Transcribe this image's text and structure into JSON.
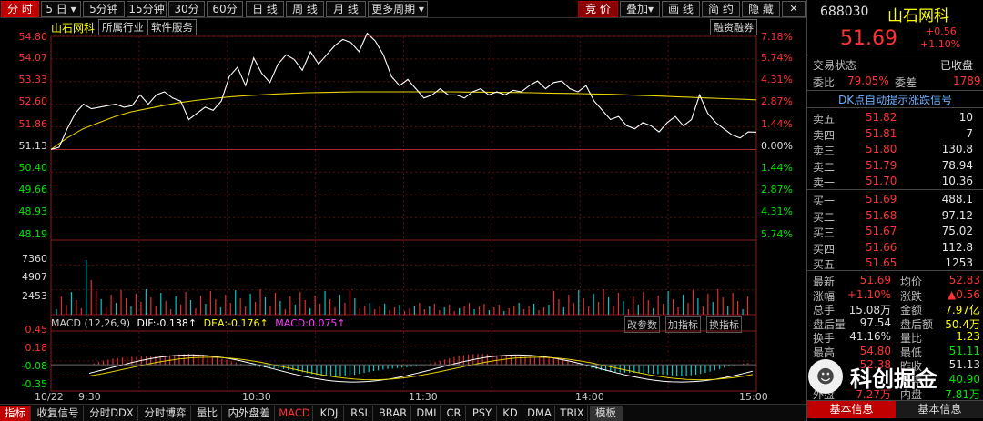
{
  "toolbar": {
    "left": [
      "分 时",
      "5 日",
      "5分钟",
      "15分钟",
      "30分钟",
      "60分钟",
      "日 线",
      "周 线",
      "月 线",
      "更多周期"
    ],
    "right": [
      "竞 价",
      "叠加",
      "画 线",
      "简 约",
      "隐 藏"
    ],
    "nav_icons": [
      "left-arrow-icon",
      "right-arrow-icon",
      "close-icon"
    ]
  },
  "chart": {
    "stock_name": "山石网科",
    "tags": [
      "所属行业",
      "软件服务"
    ],
    "margin_tag": "融资融券",
    "price_ticks": [
      "54.80",
      "54.07",
      "53.33",
      "52.60",
      "51.86",
      "51.13",
      "50.40",
      "49.66",
      "48.93",
      "48.19"
    ],
    "pct_ticks": [
      "7.18%",
      "5.74%",
      "4.31%",
      "2.87%",
      "1.44%",
      "0.00%",
      "1.44%",
      "2.87%",
      "4.31%",
      "5.74%"
    ],
    "vol_ticks": [
      "7360",
      "4907",
      "2453"
    ],
    "macd_ticks": [
      "0.45",
      "0.18",
      "-0.08",
      "-0.35"
    ],
    "macd_header": "MACD (12,26,9)",
    "dif": "DIF:-0.138↑",
    "dea": "DEA:-0.176↑",
    "macd": "MACD:0.075↑",
    "macd_buttons": [
      "改参数",
      "加指标",
      "换指标"
    ],
    "time_labels": [
      "10/22",
      "9:30",
      "10:30",
      "11:30",
      "14:00",
      "15:00"
    ],
    "colors": {
      "price_line": "#ffffff",
      "avg_line": "#e6d200",
      "up": "#ff3232",
      "down": "#00d2d2",
      "grid": "#7a1a1a"
    },
    "chart_data": {
      "type": "line",
      "title": "",
      "series": [
        {
          "name": "",
          "values": [
            51.13,
            51.2,
            51.8,
            52.3,
            52.6,
            52.45,
            52.5,
            52.55,
            52.6,
            52.5,
            52.55,
            52.9,
            52.6,
            52.9,
            53.0,
            52.8,
            52.7,
            52.1,
            52.3,
            52.5,
            52.4,
            52.7,
            53.5,
            53.8,
            53.2,
            54.1,
            53.6,
            53.3,
            53.9,
            54.2,
            54.05,
            53.7,
            54.3,
            53.9,
            54.2,
            54.5,
            54.7,
            54.6,
            54.3,
            54.9,
            54.65,
            54.2,
            53.5,
            53.2,
            53.4,
            53.1,
            52.8,
            52.9,
            53.1,
            52.9,
            52.9,
            52.8,
            53.0,
            53.1,
            52.9,
            53.0,
            52.9,
            53.05,
            53.0,
            53.2,
            53.35,
            53.1,
            53.3,
            53.35,
            53.1,
            53.0,
            53.2,
            52.7,
            52.4,
            52.1,
            52.2,
            51.9,
            51.8,
            52.0,
            51.9,
            51.7,
            52.0,
            52.2,
            51.9,
            52.1,
            52.9,
            52.3,
            52.0,
            51.8,
            51.6,
            51.5,
            51.7,
            51.69
          ]
        },
        {
          "name": "",
          "values": [
            51.13,
            51.5,
            51.8,
            52.0,
            52.2,
            52.35,
            52.45,
            52.55,
            52.65,
            52.72,
            52.78,
            52.83,
            52.87,
            52.9,
            52.93,
            52.95,
            52.97,
            52.98,
            52.99,
            53.0,
            53.0,
            53.0,
            53.0,
            53.0,
            53.0,
            53.0,
            52.99,
            52.99,
            52.98,
            52.98,
            52.97,
            52.96,
            52.95,
            52.94,
            52.93,
            52.92,
            52.9,
            52.88,
            52.86,
            52.84,
            52.82,
            52.8,
            52.78,
            52.76,
            52.74
          ]
        }
      ],
      "ylim": [
        48.19,
        54.8
      ]
    }
  },
  "bottom_tabs": [
    "指标",
    "收复信号",
    "分时DDX",
    "分时博弈",
    "量比",
    "内外盘差",
    "MACD",
    "KDJ",
    "RSI",
    "BRAR",
    "DMI",
    "CR",
    "PSY",
    "KD",
    "DMA",
    "TRIX",
    "模板"
  ],
  "side": {
    "code": "688030",
    "name": "山石网科",
    "price": "51.69",
    "change": "+0.56",
    "change_pct": "+1.10%",
    "status_label": "交易状态",
    "status_value": "已收盘",
    "weibi_label": "委比",
    "weibi_value": "79.05%",
    "weicha_label": "委差",
    "weicha_value": "1789",
    "signal": "DK点自动提示涨跌信号",
    "asks": [
      {
        "label": "卖五",
        "price": "51.82",
        "vol": "10"
      },
      {
        "label": "卖四",
        "price": "51.81",
        "vol": "7"
      },
      {
        "label": "卖三",
        "price": "51.80",
        "vol": "130.8"
      },
      {
        "label": "卖二",
        "price": "51.79",
        "vol": "78.94"
      },
      {
        "label": "卖一",
        "price": "51.70",
        "vol": "10.36"
      }
    ],
    "bids": [
      {
        "label": "买一",
        "price": "51.69",
        "vol": "488.1"
      },
      {
        "label": "买二",
        "price": "51.68",
        "vol": "97.12"
      },
      {
        "label": "买三",
        "price": "51.67",
        "vol": "75.02"
      },
      {
        "label": "买四",
        "price": "51.66",
        "vol": "112.8"
      },
      {
        "label": "买五",
        "price": "51.65",
        "vol": "1253"
      }
    ],
    "stats": [
      {
        "l1": "最新",
        "v1": "51.69",
        "l2": "均价",
        "v2": "52.83"
      },
      {
        "l1": "涨幅",
        "v1": "+1.10%",
        "l2": "涨跌",
        "v2": "▲0.56"
      },
      {
        "l1": "总手",
        "v1": "15.08万",
        "l2": "金额",
        "v2": "7.97亿"
      },
      {
        "l1": "盘后量",
        "v1": "97.54",
        "l2": "盘后额",
        "v2": "50.4万"
      },
      {
        "l1": "换手",
        "v1": "41.16%",
        "l2": "量比",
        "v2": "1.23"
      },
      {
        "l1": "最高",
        "v1": "54.80",
        "l2": "最低",
        "v2": "51.11"
      },
      {
        "l1": "今开",
        "v1": "52.38",
        "l2": "昨收",
        "v2": "51.13"
      },
      {
        "l1": "涨停",
        "v1": "",
        "l2": "跌停",
        "v2": "40.90"
      },
      {
        "l1": "外盘",
        "v1": "7.27万",
        "l2": "内盘",
        "v2": "7.81万"
      }
    ],
    "tabs": [
      "基本信息",
      "基本信息"
    ],
    "watermark": "科创掘金"
  }
}
